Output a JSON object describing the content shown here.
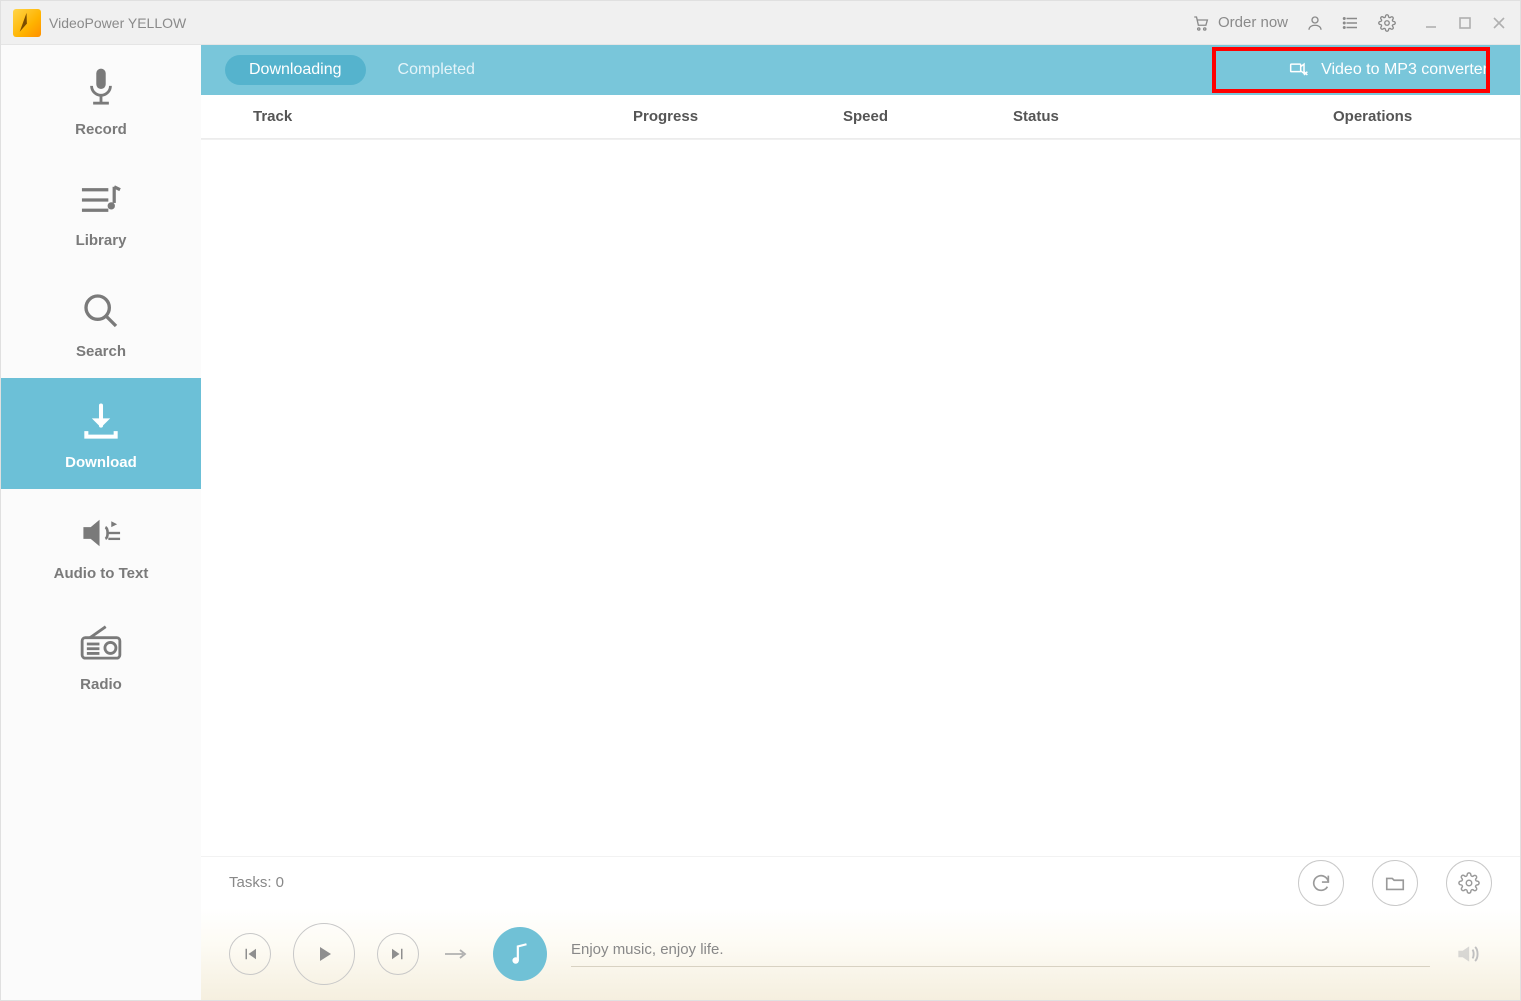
{
  "titlebar": {
    "app_name": "VideoPower YELLOW",
    "order_now": "Order now"
  },
  "sidebar": {
    "items": [
      {
        "label": "Record"
      },
      {
        "label": "Library"
      },
      {
        "label": "Search"
      },
      {
        "label": "Download"
      },
      {
        "label": "Audio to Text"
      },
      {
        "label": "Radio"
      }
    ]
  },
  "tabs": {
    "downloading": "Downloading",
    "completed": "Completed",
    "converter": "Video to MP3 converter"
  },
  "table": {
    "headers": {
      "track": "Track",
      "progress": "Progress",
      "speed": "Speed",
      "status": "Status",
      "operations": "Operations"
    }
  },
  "tasks": {
    "label": "Tasks: 0"
  },
  "player": {
    "now_playing": "Enjoy music, enjoy life."
  }
}
